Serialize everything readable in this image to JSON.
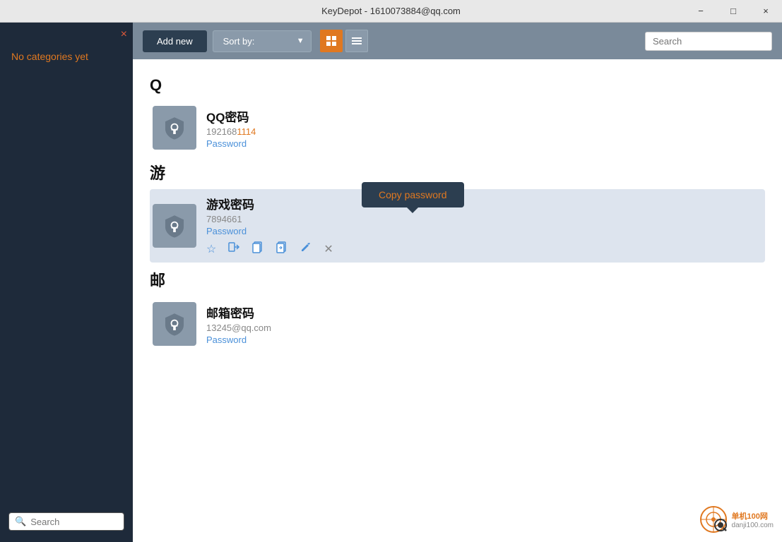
{
  "titlebar": {
    "title": "KeyDepot - 1610073884@qq.com",
    "minimize_label": "−",
    "maximize_label": "□",
    "close_label": "×"
  },
  "sidebar": {
    "no_categories_text": "No categories yet",
    "close_icon": "×",
    "search_placeholder": "Search"
  },
  "toolbar": {
    "add_new_label": "Add new",
    "sort_label": "Sort by:",
    "search_placeholder": "Search",
    "view_grid_icon": "⊞",
    "view_list_icon": "☰"
  },
  "sections": [
    {
      "header": "Q",
      "entries": [
        {
          "name": "QQ密码",
          "username": "1921681114",
          "username_highlight_start": 6,
          "username_highlight_end": 10,
          "type": "Password",
          "selected": false
        }
      ]
    },
    {
      "header": "游",
      "entries": [
        {
          "name": "游戏密码",
          "username": "7894661",
          "username_highlight_start": 0,
          "username_highlight_end": 0,
          "type": "Password",
          "selected": true
        }
      ]
    },
    {
      "header": "邮",
      "entries": [
        {
          "name": "邮箱密码",
          "username": "13245@qq.com",
          "username_highlight_start": 0,
          "username_highlight_end": 0,
          "type": "Password",
          "selected": false
        }
      ]
    }
  ],
  "tooltip": {
    "copy_password_label": "Copy password"
  },
  "actions": {
    "star": "★",
    "login": "⇥",
    "copy_user": "⎘",
    "copy_pass": "⎗",
    "edit": "✎",
    "close": "✕"
  },
  "watermark": {
    "text": "单机100网",
    "subtext": "danji100.com"
  }
}
